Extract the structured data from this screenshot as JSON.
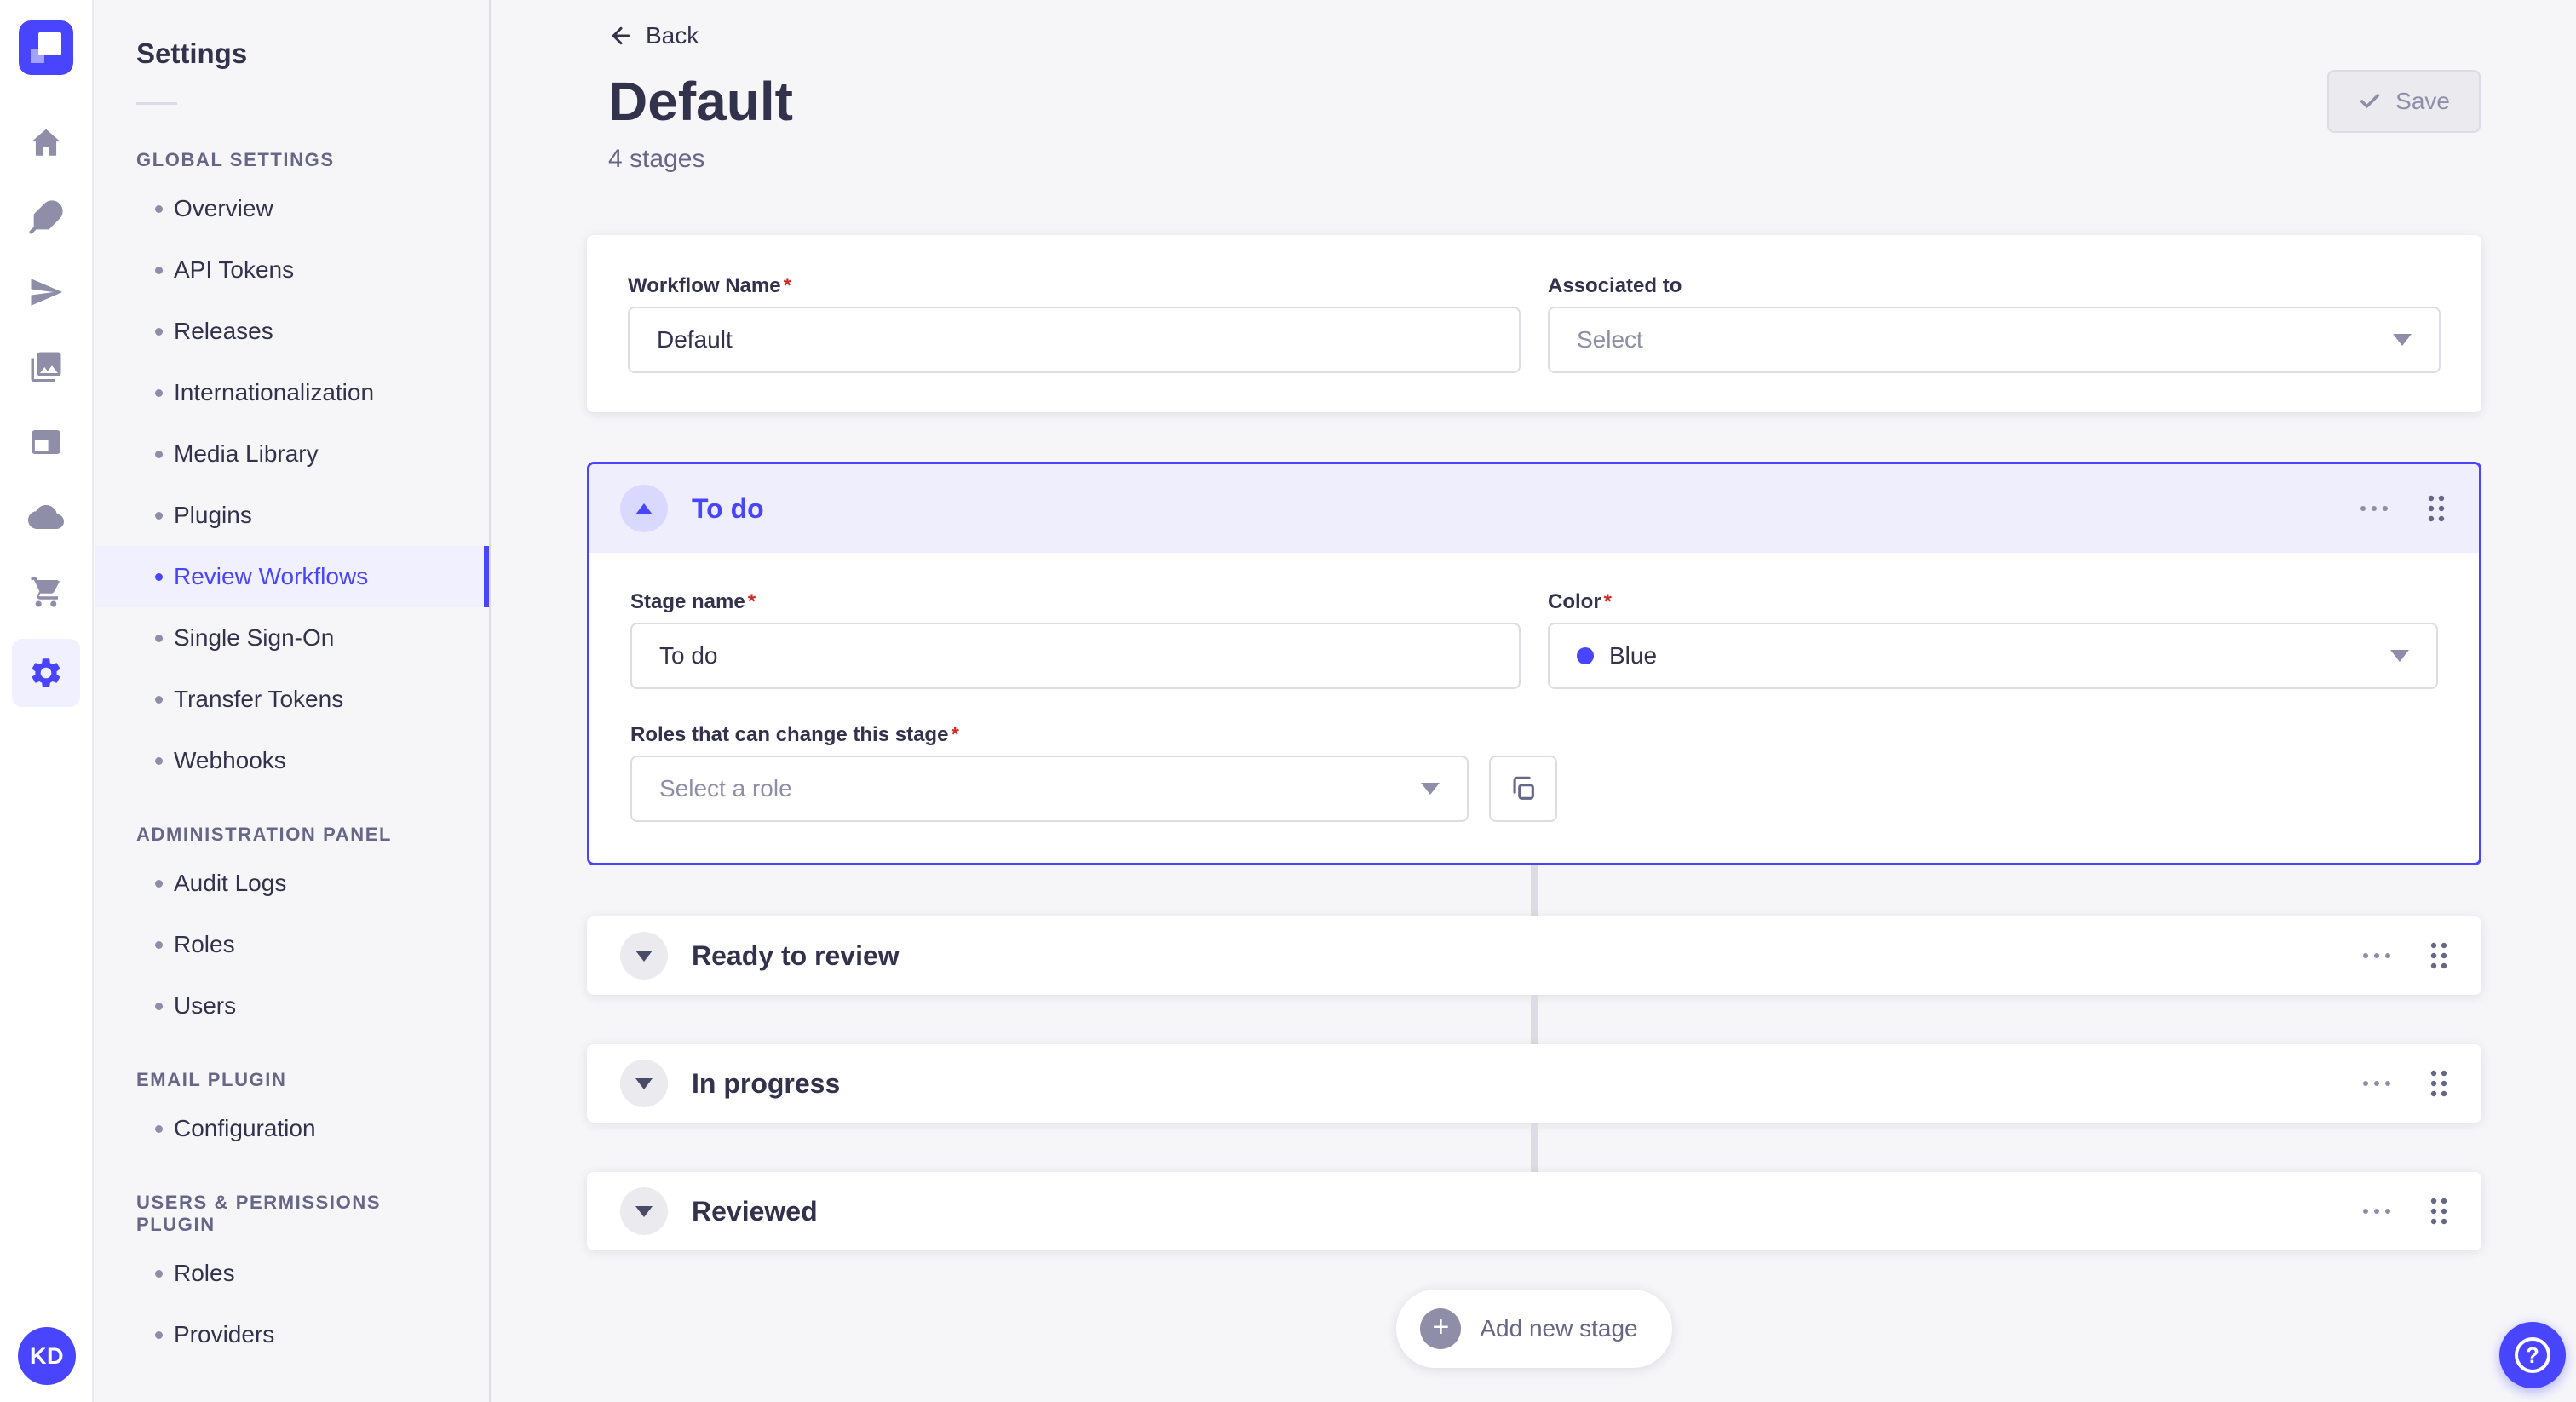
{
  "colors": {
    "primary": "#4945ff",
    "primary_light": "#f0f0ff",
    "stage_header_bg": "#eeeefc",
    "text": "#32324d",
    "muted": "#666687",
    "placeholder": "#8e8ea9",
    "border": "#dcdce4",
    "background": "#f6f6f9",
    "required_asterisk": "#d02b20",
    "stage_color_dot": "#4945ff"
  },
  "rail": {
    "icons": [
      "home",
      "feather",
      "send",
      "pictures",
      "layout",
      "cloud",
      "cart",
      "gear"
    ],
    "active_icon": "gear",
    "avatar_initials": "KD"
  },
  "sidebar": {
    "title": "Settings",
    "sections": [
      {
        "label": "GLOBAL SETTINGS",
        "items": [
          {
            "label": "Overview"
          },
          {
            "label": "API Tokens"
          },
          {
            "label": "Releases"
          },
          {
            "label": "Internationalization"
          },
          {
            "label": "Media Library"
          },
          {
            "label": "Plugins"
          },
          {
            "label": "Review Workflows",
            "active": true
          },
          {
            "label": "Single Sign-On"
          },
          {
            "label": "Transfer Tokens"
          },
          {
            "label": "Webhooks"
          }
        ]
      },
      {
        "label": "ADMINISTRATION PANEL",
        "items": [
          {
            "label": "Audit Logs"
          },
          {
            "label": "Roles"
          },
          {
            "label": "Users"
          }
        ]
      },
      {
        "label": "EMAIL PLUGIN",
        "items": [
          {
            "label": "Configuration"
          }
        ]
      },
      {
        "label": "USERS & PERMISSIONS PLUGIN",
        "items": [
          {
            "label": "Roles"
          },
          {
            "label": "Providers"
          }
        ]
      }
    ]
  },
  "header": {
    "back_label": "Back",
    "title": "Default",
    "subtitle": "4 stages",
    "save_label": "Save"
  },
  "workflow_form": {
    "name": {
      "label": "Workflow Name",
      "required": true,
      "value": "Default"
    },
    "associated_to": {
      "label": "Associated to",
      "placeholder": "Select"
    }
  },
  "stages": [
    {
      "name": "To do",
      "state": "expanded",
      "fields": {
        "stage_name": {
          "label": "Stage name",
          "required": true,
          "value": "To do"
        },
        "color": {
          "label": "Color",
          "required": true,
          "value": "Blue",
          "hex": "#4945ff"
        },
        "roles": {
          "label": "Roles that can change this stage",
          "required": true,
          "placeholder": "Select a role"
        }
      }
    },
    {
      "name": "Ready to review",
      "state": "collapsed"
    },
    {
      "name": "In progress",
      "state": "collapsed"
    },
    {
      "name": "Reviewed",
      "state": "collapsed"
    }
  ],
  "footer": {
    "add_stage_label": "Add new stage"
  }
}
